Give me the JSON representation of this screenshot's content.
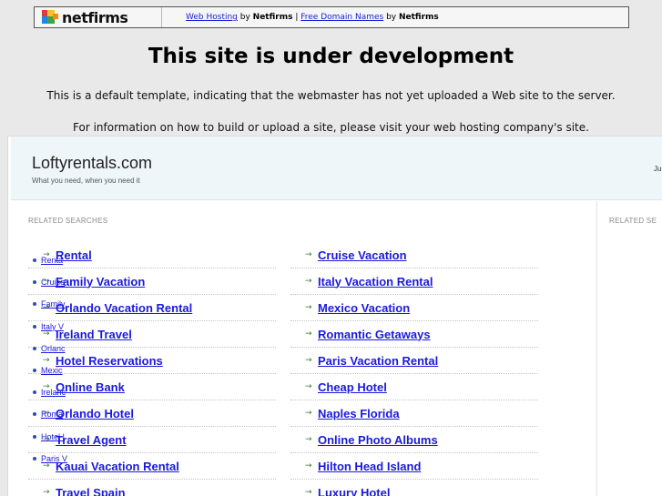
{
  "netfirms_bar": {
    "logo_text": "netfirms",
    "link_web_hosting": "Web Hosting",
    "by_1": " by ",
    "brand_1": "Netfirms",
    "separator": " | ",
    "link_domain_names": "Free Domain Names",
    "by_2": " by ",
    "brand_2": "Netfirms"
  },
  "notice": {
    "title": "This site is under development",
    "line1": "This is a default template, indicating that the webmaster has not yet uploaded a Web site to the server.",
    "line2": "For information on how to build or upload a site, please visit your web hosting company's site."
  },
  "site": {
    "name": "Loftyrentals.com",
    "tagline": "What you need, when you need it",
    "header_right_text": "Ju"
  },
  "main": {
    "section_label": "RELATED SEARCHES",
    "left_links": [
      "Rental",
      "Family Vacation",
      "Orlando Vacation Rental",
      "Ireland Travel",
      "Hotel Reservations",
      "Online Bank",
      "Orlando Hotel",
      "Travel Agent",
      "Kauai Vacation Rental",
      "Travel Spain"
    ],
    "right_links": [
      "Cruise Vacation",
      "Italy Vacation Rental",
      "Mexico Vacation",
      "Romantic Getaways",
      "Paris Vacation Rental",
      "Cheap Hotel",
      "Naples Florida",
      "Online Photo Albums",
      "Hilton Head Island",
      "Luxury Hotel"
    ]
  },
  "sidebar": {
    "section_label": "RELATED SE",
    "links": [
      "Renta",
      "Cruise",
      "Family",
      "Italy V",
      "Orlanc",
      "Mexic",
      "Irelanc",
      "Roma",
      "Hotel I",
      "Paris V"
    ]
  },
  "icons": {
    "list_arrow": "→",
    "logo_mark": "netfirms-logo-mark"
  },
  "colors": {
    "link": "#1a1adb",
    "arrow": "#2e7d32",
    "header_bg": "#eef6fa",
    "page_bg": "#e9e9e9"
  }
}
